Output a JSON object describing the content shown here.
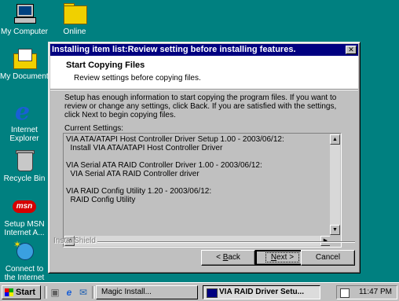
{
  "desktop": {
    "icons": [
      {
        "label": "My Computer",
        "icon": "computer-icon"
      },
      {
        "label": "Online",
        "icon": "folder-icon"
      },
      {
        "label": "My Documents",
        "icon": "documents-icon"
      },
      {
        "label": "Internet Explorer",
        "icon": "internet-explorer-icon"
      },
      {
        "label": "Recycle Bin",
        "icon": "recycle-bin-icon"
      },
      {
        "label": "Setup MSN Internet A...",
        "icon": "msn-icon"
      },
      {
        "label": "Connect to the Internet",
        "icon": "connect-icon"
      }
    ],
    "background": "#008080"
  },
  "dialog": {
    "title": "Installing item list:Review setting before installing features.",
    "close_label": "✕",
    "header_title": "Start Copying Files",
    "header_subtitle": "Review settings before copying files.",
    "intro_text": "Setup has enough information to start copying the program files.  If you want to review or change any settings, click Back.  If you are satisfied with the settings, click Next to begin copying files.",
    "current_settings_label": "Current Settings:",
    "settings_text": "VIA ATA/ATAPI Host Controller Driver Setup 1.00 - 2003/06/12:\n  Install VIA ATA/ATAPI Host Controller Driver\n\nVIA Serial ATA RAID Controller Driver 1.00 - 2003/06/12:\n  VIA Serial ATA RAID Controller driver\n\nVIA RAID Config Utility 1.20 - 2003/06/12:\n  RAID Config Utility",
    "brand": "InstallShield",
    "buttons": {
      "back": {
        "prefix": "< ",
        "key": "B",
        "rest": "ack"
      },
      "next": {
        "key": "N",
        "rest": "ext >"
      },
      "cancel": "Cancel"
    }
  },
  "taskbar": {
    "start_label": "Start",
    "tasks": [
      "Magic Install...",
      "VIA RAID Driver Setu..."
    ],
    "clock": "11:47 PM"
  }
}
